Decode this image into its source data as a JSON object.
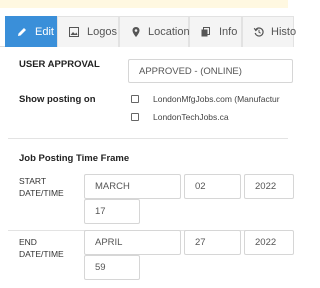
{
  "tabs": [
    {
      "label": "Edit",
      "icon": "pencil-icon",
      "active": true
    },
    {
      "label": "Logos",
      "icon": "image-icon",
      "active": false
    },
    {
      "label": "Location",
      "icon": "map-pin-icon",
      "active": false
    },
    {
      "label": "Info",
      "icon": "copy-icon",
      "active": false
    },
    {
      "label": "Histo",
      "icon": "history-icon",
      "active": false
    }
  ],
  "approval": {
    "label": "USER APPROVAL",
    "value": "APPROVED - (ONLINE)"
  },
  "posting": {
    "label": "Show posting on",
    "sites": [
      {
        "label": "LondonMfgJobs.com (Manufactur",
        "checked": false
      },
      {
        "label": "LondonTechJobs.ca",
        "checked": false
      }
    ]
  },
  "timeframe": {
    "heading": "Job Posting Time Frame",
    "start": {
      "label_line1": "START",
      "label_line2": "DATE/TIME",
      "month": "MARCH",
      "day": "02",
      "year": "2022",
      "time": "17"
    },
    "end": {
      "label_line1": "END",
      "label_line2": "DATE/TIME",
      "month": "APRIL",
      "day": "27",
      "year": "2022",
      "time": "59"
    }
  },
  "colors": {
    "accent": "#3a8fd9",
    "banner": "#fff8e1"
  }
}
